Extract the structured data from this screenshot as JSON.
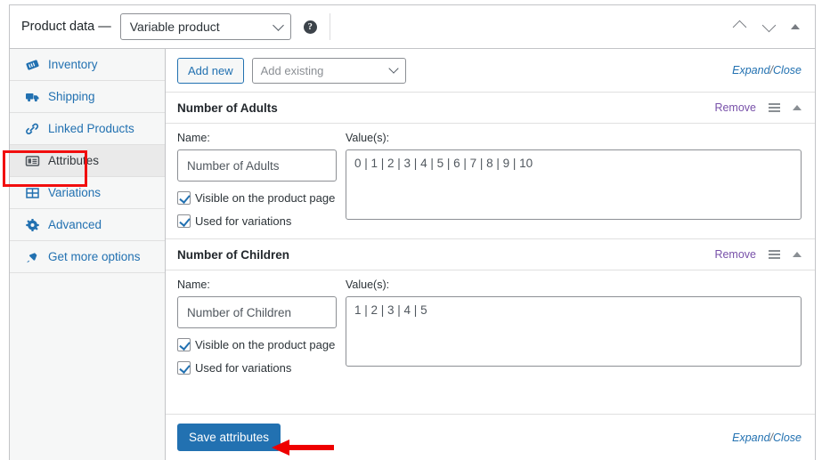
{
  "header": {
    "label": "Product data —",
    "product_type": "Variable product",
    "help_icon": "help-circle-icon",
    "move_up_icon": "chevron-up-icon",
    "move_down_icon": "chevron-down-icon",
    "collapse_icon": "triangle-up-icon"
  },
  "sidebar": {
    "items": [
      {
        "label": "Inventory",
        "icon": "inventory-tag-icon",
        "active": false
      },
      {
        "label": "Shipping",
        "icon": "truck-icon",
        "active": false
      },
      {
        "label": "Linked Products",
        "icon": "link-chain-icon",
        "active": false
      },
      {
        "label": "Attributes",
        "icon": "attributes-list-icon",
        "active": true
      },
      {
        "label": "Variations",
        "icon": "grid-table-icon",
        "active": false
      },
      {
        "label": "Advanced",
        "icon": "gear-icon",
        "active": false
      },
      {
        "label": "Get more options",
        "icon": "plug-icon",
        "active": false
      }
    ]
  },
  "toolbar": {
    "add_new_label": "Add new",
    "add_existing_placeholder": "Add existing",
    "expand_label": "Expand",
    "separator": "/",
    "close_label": "Close"
  },
  "attributes": [
    {
      "title": "Number of Adults",
      "remove_label": "Remove",
      "name_label": "Name:",
      "values_label": "Value(s):",
      "name_value": "Number of Adults",
      "values_value": "0 | 1 | 2 | 3 | 4 | 5 | 6 | 7 | 8 | 9 | 10",
      "visible_label": "Visible on the product page",
      "variations_label": "Used for variations",
      "visible_checked": true,
      "variations_checked": true
    },
    {
      "title": "Number of Children",
      "remove_label": "Remove",
      "name_label": "Name:",
      "values_label": "Value(s):",
      "name_value": "Number of Children",
      "values_value": "1 | 2 | 3 | 4 | 5",
      "visible_label": "Visible on the product page",
      "variations_label": "Used for variations",
      "visible_checked": true,
      "variations_checked": true
    }
  ],
  "footer": {
    "save_label": "Save attributes",
    "expand_label": "Expand",
    "separator": "/",
    "close_label": "Close"
  },
  "annotations": {
    "highlight_color": "#f10e0e",
    "arrow_color": "#ee0000",
    "highlight_target": "Attributes",
    "arrow_target": "Save attributes"
  },
  "colors": {
    "accent_blue": "#2271b1",
    "link_purple": "#7851a9",
    "panel_border": "#c3c4c7",
    "sidebar_bg": "#f6f7f7",
    "active_tab_bg": "#eaeaea"
  }
}
